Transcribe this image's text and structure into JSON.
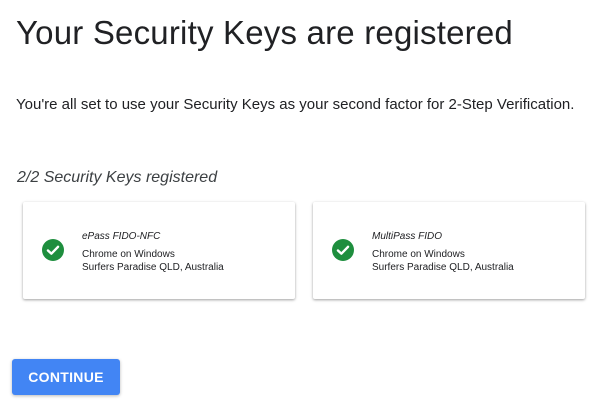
{
  "page": {
    "title": "Your Security Keys are registered",
    "description": "You're all set to use your Security Keys as your second factor for 2-Step Verification.",
    "count_text": "2/2 Security Keys registered"
  },
  "keys": [
    {
      "name": "ePass FIDO-NFC",
      "browser": "Chrome on Windows",
      "location": "Surfers Paradise QLD, Australia",
      "icon": "check-circle-icon"
    },
    {
      "name": "MultiPass FIDO",
      "browser": "Chrome on Windows",
      "location": "Surfers Paradise QLD, Australia",
      "icon": "check-circle-icon"
    }
  ],
  "actions": {
    "continue_label": "CONTINUE"
  },
  "colors": {
    "accent": "#4285f4",
    "success": "#1e8e3e"
  }
}
